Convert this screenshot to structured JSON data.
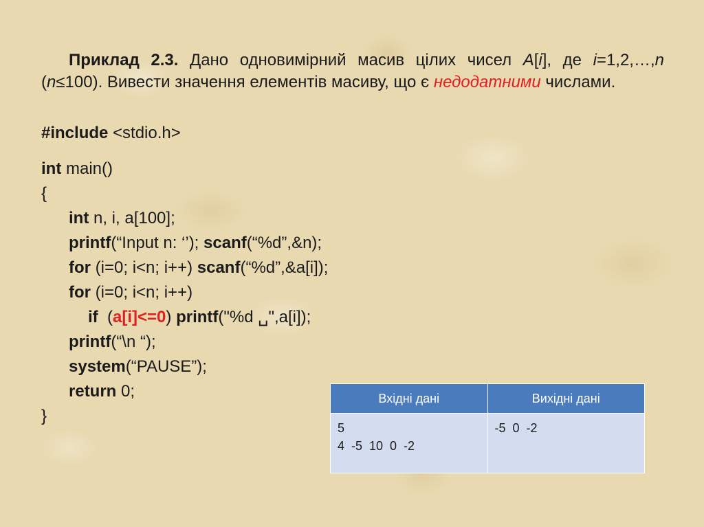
{
  "task": {
    "label": "Приклад 2.3.",
    "text1": " Дано одновимірний масив цілих чисел ",
    "var_a": "A",
    "bracket_open": "[",
    "var_i": "i",
    "bracket_close": "], де ",
    "var_i2": "i",
    "text2": "=1,2,…,",
    "var_n": "n",
    "text3": " (",
    "var_n2": "n",
    "text4": "≤100). Вивести значення елементів масиву, що є ",
    "highlight": "недодатними",
    "text5": " числами."
  },
  "code": {
    "include_kw": "#include",
    "include_rest": " <stdio.h>",
    "int_kw": "int",
    "main_rest": " main()",
    "brace_open": "{",
    "l1_kw": "int",
    "l1_rest": " n, i, a[100];",
    "l2_kw": "printf",
    "l2_rest": "(“Input n: ‘’); ",
    "l2_kw2": "scanf",
    "l2_rest2": "(“%d”,&n);",
    "l3_kw": "for",
    "l3_rest": " (i=0; i<n; i++) ",
    "l3_kw2": "scanf",
    "l3_rest2": "(“%d”,&a[i]);",
    "l4_kw": "for",
    "l4_rest": " (i=0; i<n; i++)",
    "l5_kw": "if",
    "l5_pre": "  (",
    "l5_cond": "a[i]<=0",
    "l5_post": ") ",
    "l5_kw2": "printf",
    "l5_rest": "(\"%d ␣\",a[i]);",
    "l6_kw": "printf",
    "l6_rest": "(“\\n “);",
    "l7_kw": "system",
    "l7_rest": "(“PAUSE”);",
    "l8_kw": "return",
    "l8_rest": " 0;",
    "brace_close": "}"
  },
  "io_table": {
    "header_in": "Вхідні дані",
    "header_out": "Вихідні дані",
    "input_line1": "5",
    "input_line2": "4  -5  10  0  -2",
    "output_line1": "-5  0  -2"
  },
  "colors": {
    "highlight": "#e02020",
    "table_header": "#4a7bbd",
    "table_cell": "#d3ddef"
  }
}
